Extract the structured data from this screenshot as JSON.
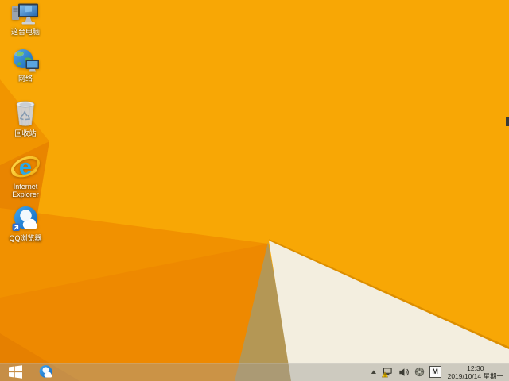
{
  "desktop": {
    "icons": [
      {
        "name": "this-pc",
        "label": "这台电脑"
      },
      {
        "name": "network",
        "label": "网络"
      },
      {
        "name": "recycle-bin",
        "label": "回收站"
      },
      {
        "name": "internet-explorer",
        "label": "Internet Explorer"
      },
      {
        "name": "qq-browser",
        "label": "QQ浏览器"
      }
    ]
  },
  "taskbar": {
    "start_button": "windows-start",
    "pinned": [
      {
        "name": "qq-browser"
      }
    ],
    "tray": {
      "icons": [
        "show-hidden-icons",
        "network-warning",
        "volume",
        "target-utility",
        "ime-indicator"
      ],
      "ime": "M",
      "time": "12:30",
      "date": "2019/10/14 星期一"
    }
  },
  "colors": {
    "wallpaper_bright_orange": "#F8A705",
    "wallpaper_medium_orange": "#F19100",
    "wallpaper_dark_orange": "#E98500",
    "wallpaper_deep_corner": "#E68000",
    "wallpaper_khaki_facet": "#B49755",
    "wallpaper_cream_facet": "#F3EEDF",
    "wallpaper_ridge": "#DC8E00",
    "taskbar_tint": "rgba(162,160,152,0.46)",
    "ie_blue": "#2AA9E8",
    "ie_gold": "#F6C40E",
    "qq_blue": "#1E7FD6",
    "label_text": "#FFFFFF",
    "clock_text": "#26261F"
  }
}
